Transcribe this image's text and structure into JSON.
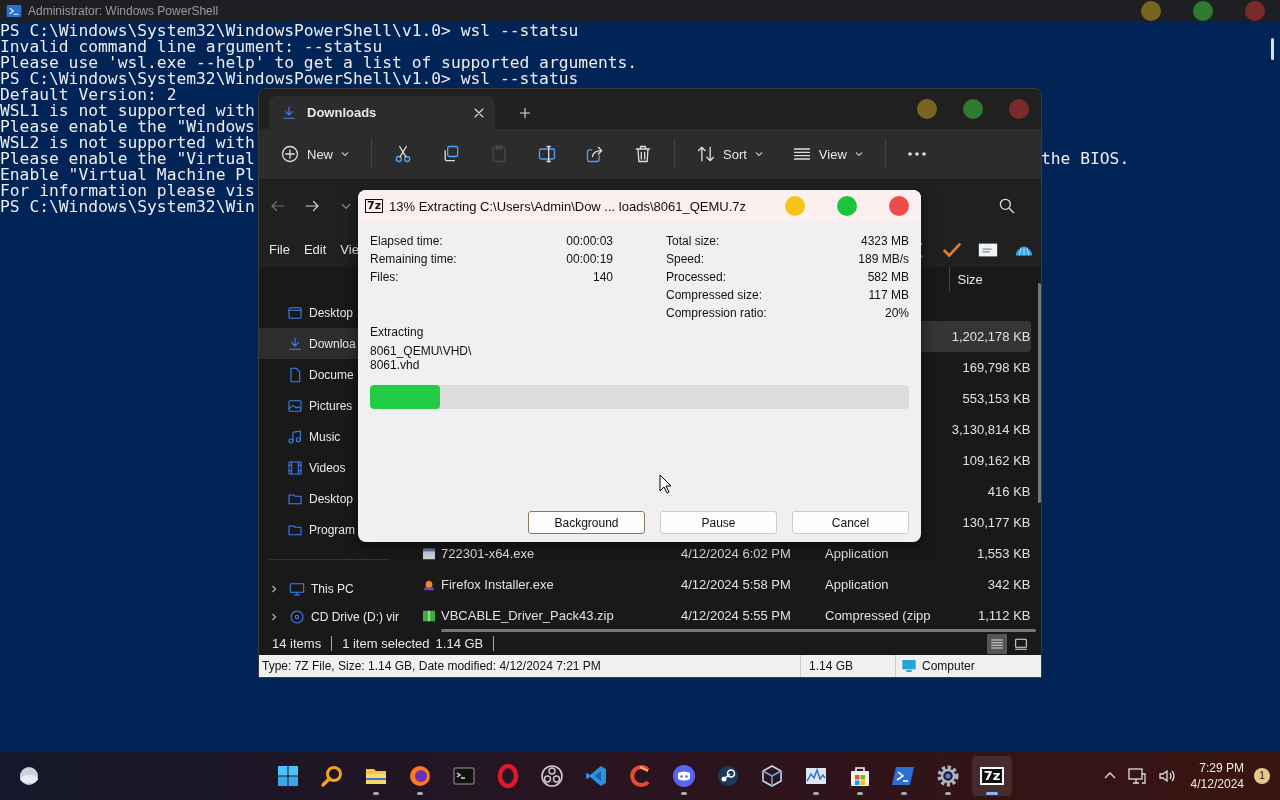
{
  "powershell": {
    "title": "Administrator: Windows PowerShell",
    "lines": [
      {
        "text": "PS C:\\Windows\\System32\\WindowsPowerShell\\v1.0> wsl --statsu"
      },
      {
        "text": "Invalid command line argument: --statsu"
      },
      {
        "text": "Please use 'wsl.exe --help' to get a list of supported arguments."
      },
      {
        "text": "PS C:\\Windows\\System32\\WindowsPowerShell\\v1.0> wsl --status"
      },
      {
        "text": "Default Version: 2"
      },
      {
        "text": "WSL1 is not supported with"
      },
      {
        "text": "Please enable the \"Windows"
      },
      {
        "text": "WSL2 is not supported with"
      },
      {
        "text": "Please enable the \"Virtual",
        "tail": "the BIOS."
      },
      {
        "text": "Enable \"Virtual Machine Pl"
      },
      {
        "text": "For information please vis"
      },
      {
        "text": "PS C:\\Windows\\System32\\Win"
      }
    ]
  },
  "explorer": {
    "tab": {
      "title": "Downloads"
    },
    "toolbar": [
      {
        "kind": "new",
        "label": "New",
        "disabled": false
      },
      {
        "kind": "cut",
        "disabled": false
      },
      {
        "kind": "copy",
        "disabled": false
      },
      {
        "kind": "paste",
        "disabled": true
      },
      {
        "kind": "rename",
        "disabled": false
      },
      {
        "kind": "share",
        "disabled": false
      },
      {
        "kind": "delete",
        "disabled": false
      },
      {
        "kind": "sort",
        "label": "Sort",
        "disabled": false
      },
      {
        "kind": "view",
        "label": "View",
        "disabled": false
      },
      {
        "kind": "more",
        "disabled": false
      }
    ],
    "menu": [
      "File",
      "Edit",
      "Vie"
    ],
    "app_icons": [
      {
        "kind": "cross"
      },
      {
        "kind": "check"
      },
      {
        "kind": "envelope"
      },
      {
        "kind": "shell"
      }
    ],
    "size_header": "Size",
    "sidebar": [
      {
        "kind": "desktop",
        "label": "Desktop",
        "selected": false
      },
      {
        "kind": "downloads",
        "label": "Downloa",
        "selected": true
      },
      {
        "kind": "documents",
        "label": "Docume",
        "selected": false
      },
      {
        "kind": "pictures",
        "label": "Pictures",
        "selected": false
      },
      {
        "kind": "music",
        "label": "Music",
        "selected": false
      },
      {
        "kind": "videos",
        "label": "Videos",
        "selected": false
      },
      {
        "kind": "folder",
        "label": "Desktop",
        "selected": false
      },
      {
        "kind": "folder",
        "label": "Program",
        "selected": false
      }
    ],
    "devices": [
      {
        "kind": "pc",
        "label": "This PC",
        "expanded": false
      },
      {
        "kind": "disc",
        "label": "CD Drive (D:) vir",
        "expanded": false
      }
    ],
    "files": [
      {
        "size": "1,202,178 KB",
        "selected": true
      },
      {
        "size": "169,798 KB",
        "selected": false
      },
      {
        "size": "553,153 KB",
        "selected": false
      },
      {
        "size": "3,130,814 KB",
        "selected": false
      },
      {
        "size": "109,162 KB",
        "selected": false
      },
      {
        "size": "416 KB",
        "selected": false
      },
      {
        "size": "130,177 KB",
        "selected": false
      },
      {
        "kind": "exe",
        "name": "722301-x64.exe",
        "date": "4/12/2024 6:02 PM",
        "type": "Application",
        "size": "1,553 KB",
        "selected": false
      },
      {
        "kind": "installer",
        "name": "Firefox Installer.exe",
        "date": "4/12/2024 5:58 PM",
        "type": "Application",
        "size": "342 KB",
        "selected": false
      },
      {
        "kind": "zip",
        "name": "VBCABLE_Driver_Pack43.zip",
        "date": "4/12/2024 5:55 PM",
        "type": "Compressed (zipp",
        "size": "1,112 KB",
        "selected": false
      }
    ],
    "status": {
      "count": "14 items",
      "selection": "1 item selected",
      "selection_size": "1.14 GB"
    },
    "view_modes": [
      {
        "kind": "details",
        "selected": true
      },
      {
        "kind": "tiles",
        "selected": false
      }
    ],
    "details_bar": {
      "info": "Type: 7Z File, Size: 1.14 GB, Date modified: 4/12/2024 7:21 PM",
      "size": "1.14 GB",
      "location": "Computer"
    }
  },
  "dialog": {
    "logo": "7z",
    "title": "13% Extracting C:\\Users\\Admin\\Dow ... loads\\8061_QEMU.7z",
    "left_stats": [
      {
        "label": "Elapsed time:",
        "value": "00:00:03"
      },
      {
        "label": "Remaining time:",
        "value": "00:00:19"
      },
      {
        "label": "Files:",
        "value": "140"
      }
    ],
    "right_stats": [
      {
        "label": "Total size:",
        "value": "4323 MB"
      },
      {
        "label": "Speed:",
        "value": "189 MB/s"
      },
      {
        "label": "Processed:",
        "value": "582 MB"
      },
      {
        "label": "Compressed size:",
        "value": "117 MB"
      },
      {
        "label": "Compression ratio:",
        "value": "20%"
      }
    ],
    "operation": "Extracting",
    "current_file": [
      "8061_QEMU\\VHD\\",
      "8061.vhd"
    ],
    "progress": {
      "level": 0.13
    },
    "buttons": [
      {
        "label": "Background",
        "default": true
      },
      {
        "label": "Pause",
        "default": false
      },
      {
        "label": "Cancel",
        "default": false
      }
    ]
  },
  "taskbar": {
    "apps": [
      {
        "kind": "start",
        "running": false,
        "selected": false
      },
      {
        "kind": "search",
        "running": false,
        "selected": false
      },
      {
        "kind": "explorer",
        "running": true,
        "selected": false
      },
      {
        "kind": "firefox",
        "running": true,
        "selected": false
      },
      {
        "kind": "terminal",
        "running": false,
        "selected": false
      },
      {
        "kind": "opera",
        "running": false,
        "selected": false
      },
      {
        "kind": "obs",
        "running": false,
        "selected": false
      },
      {
        "kind": "vscode",
        "running": false,
        "selected": false
      },
      {
        "kind": "cleaner",
        "running": false,
        "selected": false
      },
      {
        "kind": "discord",
        "running": true,
        "selected": false
      },
      {
        "kind": "steam",
        "running": false,
        "selected": false
      },
      {
        "kind": "virtualbox",
        "running": false,
        "selected": false
      },
      {
        "kind": "perfmon",
        "running": true,
        "selected": false
      },
      {
        "kind": "store",
        "running": true,
        "selected": false
      },
      {
        "kind": "powershell",
        "running": true,
        "selected": false
      },
      {
        "kind": "settings",
        "running": true,
        "selected": false
      },
      {
        "kind": "sevenzip",
        "label": "7z",
        "running": true,
        "selected": true
      }
    ],
    "clock": {
      "time": "7:29 PM",
      "date": "4/12/2024"
    },
    "notifications": "1"
  }
}
